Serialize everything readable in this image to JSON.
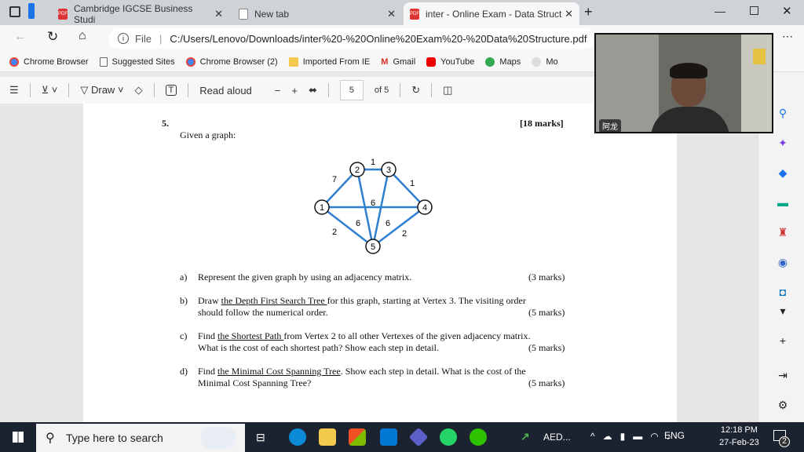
{
  "tabs": [
    {
      "label": "Cambridge IGCSE Business Studi"
    },
    {
      "label": "New tab"
    },
    {
      "label": "inter - Online Exam - Data Struct",
      "active": true
    }
  ],
  "address": {
    "scheme": "File",
    "url": "C:/Users/Lenovo/Downloads/inter%20-%20Online%20Exam%20-%20Data%20Structure.pdf"
  },
  "bookmarks": [
    {
      "label": "Chrome Browser",
      "color": "#4285f4"
    },
    {
      "label": "Suggested Sites",
      "color": "#666"
    },
    {
      "label": "Chrome Browser (2)",
      "color": "#4285f4"
    },
    {
      "label": "Imported From IE",
      "color": "#f2c94c"
    },
    {
      "label": "Gmail",
      "color": "#d93025"
    },
    {
      "label": "YouTube",
      "color": "#e00"
    },
    {
      "label": "Maps",
      "color": "#34a853"
    },
    {
      "label": "Mo",
      "color": "#ccc"
    }
  ],
  "pdf_toolbar": {
    "draw": "Draw",
    "read_aloud": "Read aloud",
    "page": "5",
    "of": "of 5"
  },
  "doc": {
    "qnum": "5.",
    "marks": "[18 marks]",
    "intro": "Given a graph:",
    "graph": {
      "nodes": [
        "1",
        "2",
        "3",
        "4",
        "5"
      ],
      "edges": [
        {
          "from": "1",
          "to": "2",
          "w": "7"
        },
        {
          "from": "2",
          "to": "3",
          "w": "1"
        },
        {
          "from": "3",
          "to": "4",
          "w": "1"
        },
        {
          "from": "1",
          "to": "4",
          "w": "6"
        },
        {
          "from": "2",
          "to": "5",
          "w": "6"
        },
        {
          "from": "3",
          "to": "5",
          "w": "6"
        },
        {
          "from": "1",
          "to": "5",
          "w": "2"
        },
        {
          "from": "4",
          "to": "5",
          "w": "2"
        }
      ],
      "edge_color": "#2f7fd0"
    },
    "a": {
      "label": "a)",
      "text": "Represent the given graph by using an adjacency matrix.",
      "marks": "(3 marks)"
    },
    "b": {
      "label": "b)",
      "pre": "Draw ",
      "u": "the Depth First Search Tree ",
      "post": "for this graph, starting at Vertex 3. The visiting order",
      "line2": "should follow the numerical order.",
      "marks": "(5 marks)"
    },
    "c": {
      "label": "c)",
      "pre": "Find ",
      "u": "the Shortest Path ",
      "post": "from Vertex 2 to all other Vertexes of the given adjacency matrix.",
      "line2": "What is the cost of each shortest path? Show each step in detail.",
      "marks": "(5 marks)"
    },
    "d": {
      "label": "d)",
      "pre": "Find ",
      "u": "the Minimal Cost Spanning Tree",
      "post": ". Show each step in detail. What is the cost of the",
      "line2": "Minimal Cost Spanning Tree?",
      "marks": "(5 marks)"
    }
  },
  "cam": {
    "name": "阿龙"
  },
  "taskbar": {
    "search_placeholder": "Type here to search",
    "weather": "AED...",
    "lang": "ENG",
    "time": "12:18 PM",
    "date": "27-Feb-23",
    "notifications": "2"
  }
}
